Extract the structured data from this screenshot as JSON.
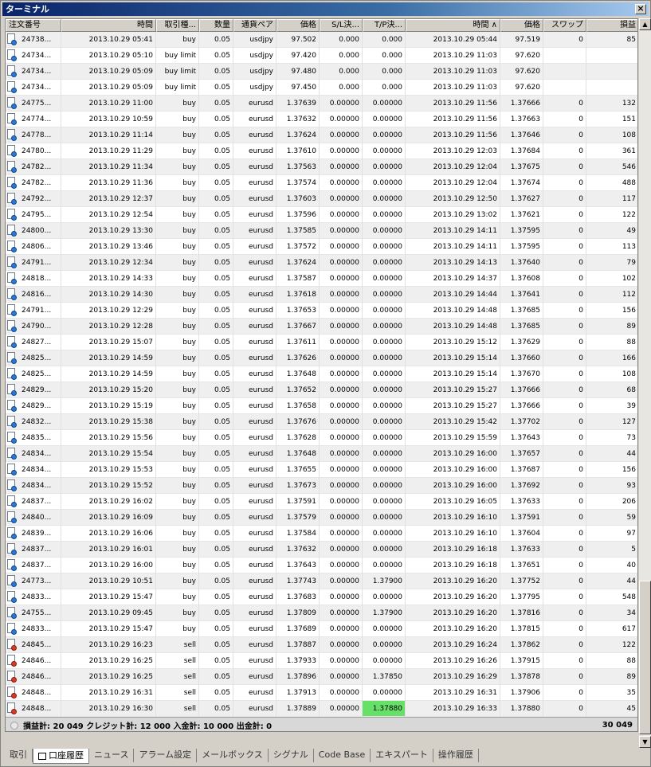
{
  "window": {
    "title": "ターミナル",
    "close_label": "×"
  },
  "columns": [
    {
      "label": "注文番号",
      "align": "left",
      "w": 70
    },
    {
      "label": "時間",
      "align": "right",
      "w": 119
    },
    {
      "label": "取引種...",
      "align": "right",
      "w": 54
    },
    {
      "label": "数量",
      "align": "right",
      "w": 43
    },
    {
      "label": "通貨ペア",
      "align": "right",
      "w": 54
    },
    {
      "label": "価格",
      "align": "right",
      "w": 54
    },
    {
      "label": "S/L決...",
      "align": "right",
      "w": 54
    },
    {
      "label": "T/P決...",
      "align": "right",
      "w": 54
    },
    {
      "label": "時間",
      "align": "right",
      "w": 119,
      "sort": "∧"
    },
    {
      "label": "価格",
      "align": "right",
      "w": 54
    },
    {
      "label": "スワップ",
      "align": "right",
      "w": 54
    },
    {
      "label": "損益",
      "align": "right",
      "w": 66
    }
  ],
  "rows": [
    [
      "24738...",
      "2013.10.29 05:41",
      "buy",
      "0.05",
      "usdjpy",
      "97.502",
      "0.000",
      "0.000",
      "2013.10.29 05:44",
      "97.519",
      "0",
      "85"
    ],
    [
      "24734...",
      "2013.10.29 05:10",
      "buy limit",
      "0.05",
      "usdjpy",
      "97.420",
      "0.000",
      "0.000",
      "2013.10.29 11:03",
      "97.620",
      "",
      ""
    ],
    [
      "24734...",
      "2013.10.29 05:09",
      "buy limit",
      "0.05",
      "usdjpy",
      "97.480",
      "0.000",
      "0.000",
      "2013.10.29 11:03",
      "97.620",
      "",
      ""
    ],
    [
      "24734...",
      "2013.10.29 05:09",
      "buy limit",
      "0.05",
      "usdjpy",
      "97.450",
      "0.000",
      "0.000",
      "2013.10.29 11:03",
      "97.620",
      "",
      ""
    ],
    [
      "24775...",
      "2013.10.29 11:00",
      "buy",
      "0.05",
      "eurusd",
      "1.37639",
      "0.00000",
      "0.00000",
      "2013.10.29 11:56",
      "1.37666",
      "0",
      "132"
    ],
    [
      "24774...",
      "2013.10.29 10:59",
      "buy",
      "0.05",
      "eurusd",
      "1.37632",
      "0.00000",
      "0.00000",
      "2013.10.29 11:56",
      "1.37663",
      "0",
      "151"
    ],
    [
      "24778...",
      "2013.10.29 11:14",
      "buy",
      "0.05",
      "eurusd",
      "1.37624",
      "0.00000",
      "0.00000",
      "2013.10.29 11:56",
      "1.37646",
      "0",
      "108"
    ],
    [
      "24780...",
      "2013.10.29 11:29",
      "buy",
      "0.05",
      "eurusd",
      "1.37610",
      "0.00000",
      "0.00000",
      "2013.10.29 12:03",
      "1.37684",
      "0",
      "361"
    ],
    [
      "24782...",
      "2013.10.29 11:34",
      "buy",
      "0.05",
      "eurusd",
      "1.37563",
      "0.00000",
      "0.00000",
      "2013.10.29 12:04",
      "1.37675",
      "0",
      "546"
    ],
    [
      "24782...",
      "2013.10.29 11:36",
      "buy",
      "0.05",
      "eurusd",
      "1.37574",
      "0.00000",
      "0.00000",
      "2013.10.29 12:04",
      "1.37674",
      "0",
      "488"
    ],
    [
      "24792...",
      "2013.10.29 12:37",
      "buy",
      "0.05",
      "eurusd",
      "1.37603",
      "0.00000",
      "0.00000",
      "2013.10.29 12:50",
      "1.37627",
      "0",
      "117"
    ],
    [
      "24795...",
      "2013.10.29 12:54",
      "buy",
      "0.05",
      "eurusd",
      "1.37596",
      "0.00000",
      "0.00000",
      "2013.10.29 13:02",
      "1.37621",
      "0",
      "122"
    ],
    [
      "24800...",
      "2013.10.29 13:30",
      "buy",
      "0.05",
      "eurusd",
      "1.37585",
      "0.00000",
      "0.00000",
      "2013.10.29 14:11",
      "1.37595",
      "0",
      "49"
    ],
    [
      "24806...",
      "2013.10.29 13:46",
      "buy",
      "0.05",
      "eurusd",
      "1.37572",
      "0.00000",
      "0.00000",
      "2013.10.29 14:11",
      "1.37595",
      "0",
      "113"
    ],
    [
      "24791...",
      "2013.10.29 12:34",
      "buy",
      "0.05",
      "eurusd",
      "1.37624",
      "0.00000",
      "0.00000",
      "2013.10.29 14:13",
      "1.37640",
      "0",
      "79"
    ],
    [
      "24818...",
      "2013.10.29 14:33",
      "buy",
      "0.05",
      "eurusd",
      "1.37587",
      "0.00000",
      "0.00000",
      "2013.10.29 14:37",
      "1.37608",
      "0",
      "102"
    ],
    [
      "24816...",
      "2013.10.29 14:30",
      "buy",
      "0.05",
      "eurusd",
      "1.37618",
      "0.00000",
      "0.00000",
      "2013.10.29 14:44",
      "1.37641",
      "0",
      "112"
    ],
    [
      "24791...",
      "2013.10.29 12:29",
      "buy",
      "0.05",
      "eurusd",
      "1.37653",
      "0.00000",
      "0.00000",
      "2013.10.29 14:48",
      "1.37685",
      "0",
      "156"
    ],
    [
      "24790...",
      "2013.10.29 12:28",
      "buy",
      "0.05",
      "eurusd",
      "1.37667",
      "0.00000",
      "0.00000",
      "2013.10.29 14:48",
      "1.37685",
      "0",
      "89"
    ],
    [
      "24827...",
      "2013.10.29 15:07",
      "buy",
      "0.05",
      "eurusd",
      "1.37611",
      "0.00000",
      "0.00000",
      "2013.10.29 15:12",
      "1.37629",
      "0",
      "88"
    ],
    [
      "24825...",
      "2013.10.29 14:59",
      "buy",
      "0.05",
      "eurusd",
      "1.37626",
      "0.00000",
      "0.00000",
      "2013.10.29 15:14",
      "1.37660",
      "0",
      "166"
    ],
    [
      "24825...",
      "2013.10.29 14:59",
      "buy",
      "0.05",
      "eurusd",
      "1.37648",
      "0.00000",
      "0.00000",
      "2013.10.29 15:14",
      "1.37670",
      "0",
      "108"
    ],
    [
      "24829...",
      "2013.10.29 15:20",
      "buy",
      "0.05",
      "eurusd",
      "1.37652",
      "0.00000",
      "0.00000",
      "2013.10.29 15:27",
      "1.37666",
      "0",
      "68"
    ],
    [
      "24829...",
      "2013.10.29 15:19",
      "buy",
      "0.05",
      "eurusd",
      "1.37658",
      "0.00000",
      "0.00000",
      "2013.10.29 15:27",
      "1.37666",
      "0",
      "39"
    ],
    [
      "24832...",
      "2013.10.29 15:38",
      "buy",
      "0.05",
      "eurusd",
      "1.37676",
      "0.00000",
      "0.00000",
      "2013.10.29 15:42",
      "1.37702",
      "0",
      "127"
    ],
    [
      "24835...",
      "2013.10.29 15:56",
      "buy",
      "0.05",
      "eurusd",
      "1.37628",
      "0.00000",
      "0.00000",
      "2013.10.29 15:59",
      "1.37643",
      "0",
      "73"
    ],
    [
      "24834...",
      "2013.10.29 15:54",
      "buy",
      "0.05",
      "eurusd",
      "1.37648",
      "0.00000",
      "0.00000",
      "2013.10.29 16:00",
      "1.37657",
      "0",
      "44"
    ],
    [
      "24834...",
      "2013.10.29 15:53",
      "buy",
      "0.05",
      "eurusd",
      "1.37655",
      "0.00000",
      "0.00000",
      "2013.10.29 16:00",
      "1.37687",
      "0",
      "156"
    ],
    [
      "24834...",
      "2013.10.29 15:52",
      "buy",
      "0.05",
      "eurusd",
      "1.37673",
      "0.00000",
      "0.00000",
      "2013.10.29 16:00",
      "1.37692",
      "0",
      "93"
    ],
    [
      "24837...",
      "2013.10.29 16:02",
      "buy",
      "0.05",
      "eurusd",
      "1.37591",
      "0.00000",
      "0.00000",
      "2013.10.29 16:05",
      "1.37633",
      "0",
      "206"
    ],
    [
      "24840...",
      "2013.10.29 16:09",
      "buy",
      "0.05",
      "eurusd",
      "1.37579",
      "0.00000",
      "0.00000",
      "2013.10.29 16:10",
      "1.37591",
      "0",
      "59"
    ],
    [
      "24839...",
      "2013.10.29 16:06",
      "buy",
      "0.05",
      "eurusd",
      "1.37584",
      "0.00000",
      "0.00000",
      "2013.10.29 16:10",
      "1.37604",
      "0",
      "97"
    ],
    [
      "24837...",
      "2013.10.29 16:01",
      "buy",
      "0.05",
      "eurusd",
      "1.37632",
      "0.00000",
      "0.00000",
      "2013.10.29 16:18",
      "1.37633",
      "0",
      "5"
    ],
    [
      "24837...",
      "2013.10.29 16:00",
      "buy",
      "0.05",
      "eurusd",
      "1.37643",
      "0.00000",
      "0.00000",
      "2013.10.29 16:18",
      "1.37651",
      "0",
      "40"
    ],
    [
      "24773...",
      "2013.10.29 10:51",
      "buy",
      "0.05",
      "eurusd",
      "1.37743",
      "0.00000",
      "1.37900",
      "2013.10.29 16:20",
      "1.37752",
      "0",
      "44"
    ],
    [
      "24833...",
      "2013.10.29 15:47",
      "buy",
      "0.05",
      "eurusd",
      "1.37683",
      "0.00000",
      "0.00000",
      "2013.10.29 16:20",
      "1.37795",
      "0",
      "548"
    ],
    [
      "24755...",
      "2013.10.29 09:45",
      "buy",
      "0.05",
      "eurusd",
      "1.37809",
      "0.00000",
      "1.37900",
      "2013.10.29 16:20",
      "1.37816",
      "0",
      "34"
    ],
    [
      "24833...",
      "2013.10.29 15:47",
      "buy",
      "0.05",
      "eurusd",
      "1.37689",
      "0.00000",
      "0.00000",
      "2013.10.29 16:20",
      "1.37815",
      "0",
      "617"
    ],
    [
      "24845...",
      "2013.10.29 16:23",
      "sell",
      "0.05",
      "eurusd",
      "1.37887",
      "0.00000",
      "0.00000",
      "2013.10.29 16:24",
      "1.37862",
      "0",
      "122"
    ],
    [
      "24846...",
      "2013.10.29 16:25",
      "sell",
      "0.05",
      "eurusd",
      "1.37933",
      "0.00000",
      "0.00000",
      "2013.10.29 16:26",
      "1.37915",
      "0",
      "88"
    ],
    [
      "24846...",
      "2013.10.29 16:25",
      "sell",
      "0.05",
      "eurusd",
      "1.37896",
      "0.00000",
      "1.37850",
      "2013.10.29 16:29",
      "1.37878",
      "0",
      "89"
    ],
    [
      "24848...",
      "2013.10.29 16:31",
      "sell",
      "0.05",
      "eurusd",
      "1.37913",
      "0.00000",
      "0.00000",
      "2013.10.29 16:31",
      "1.37906",
      "0",
      "35"
    ],
    [
      "24848...",
      "2013.10.29 16:30",
      "sell",
      "0.05",
      "eurusd",
      "1.37889",
      "0.00000",
      "1.37880",
      "2013.10.29 16:33",
      "1.37880",
      "0",
      "45"
    ]
  ],
  "highlight": {
    "row": 42,
    "col": 7,
    "color": "#66e066"
  },
  "summary": {
    "text": "損益計: 20 049  クレジット計: 12 000  入金計: 10 000  出金計: 0",
    "total": "30 049"
  },
  "scrollbar": {
    "up": "▲",
    "down": "▼"
  },
  "tabs": [
    {
      "label": "取引",
      "active": false
    },
    {
      "label": "口座履歴",
      "active": true
    },
    {
      "label": "ニュース",
      "active": false
    },
    {
      "label": "アラーム設定",
      "active": false
    },
    {
      "label": "メールボックス",
      "active": false
    },
    {
      "label": "シグナル",
      "active": false
    },
    {
      "label": "Code Base",
      "active": false
    },
    {
      "label": "エキスパート",
      "active": false
    },
    {
      "label": "操作履歴",
      "active": false
    }
  ]
}
